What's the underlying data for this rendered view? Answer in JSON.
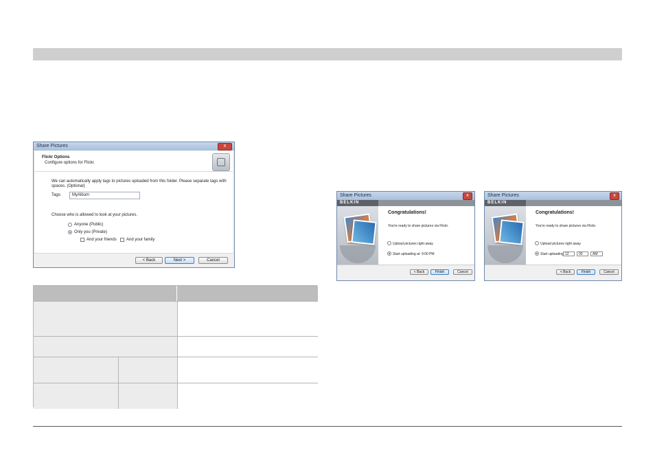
{
  "dialog_flickr": {
    "title": "Share Pictures",
    "close": "x",
    "heading": "Flickr Options",
    "subheading": "Configure options for Flickr.",
    "intro_line1": "We can automatically apply tags to pictures uploaded from this folder. Please separate tags with",
    "intro_line2": "spaces. (Optional)",
    "tags_label": "Tags:",
    "tags_value": "MyAlbum",
    "who_label": "Choose who is allowed to look at your pictures.",
    "option_anyone": "Anyone (Public)",
    "option_only_you": "Only you (Private)",
    "option_friends": "And your friends",
    "option_family": "And your family",
    "back": "< Back",
    "next": "Next >",
    "cancel": "Cancel"
  },
  "dialog_congrats_1": {
    "title": "Share Pictures",
    "brand": "BELKIN",
    "heading": "Congratulations!",
    "ready": "You're ready to share pictures via Flickr.",
    "option_now": "Upload pictures right away",
    "option_later": "Start uploading at: 9:00 PM",
    "back": "< Back",
    "finish": "Finish",
    "cancel": "Cancel"
  },
  "dialog_congrats_2": {
    "title": "Share Pictures",
    "brand": "BELKIN",
    "heading": "Congratulations!",
    "ready": "You're ready to share pictures via Flickr.",
    "option_now": "Upload pictures right away",
    "option_later": "Start uploading at:",
    "hour": "12",
    "minute": "00",
    "ampm": "AM",
    "back": "< Back",
    "finish": "Finish",
    "cancel": "Cancel"
  }
}
